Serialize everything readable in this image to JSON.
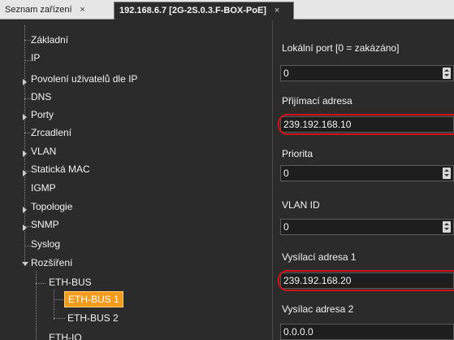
{
  "tabs": [
    {
      "label": "Seznam zařízení",
      "close": "×"
    },
    {
      "label": "192.168.6.7 [2G-2S.0.3.F-BOX-PoE]",
      "close": "×"
    }
  ],
  "tree": {
    "items": [
      {
        "label": "Základní"
      },
      {
        "label": "IP"
      },
      {
        "label": "Povolení uživatelů dle IP"
      },
      {
        "label": "DNS"
      },
      {
        "label": "Porty"
      },
      {
        "label": "Zrcadlení"
      },
      {
        "label": "VLAN"
      },
      {
        "label": "Statická MAC"
      },
      {
        "label": "IGMP"
      },
      {
        "label": "Topologie"
      },
      {
        "label": "SNMP"
      },
      {
        "label": "Syslog"
      },
      {
        "label": "Rozšíření"
      },
      {
        "label": "ETH-BUS"
      },
      {
        "label": "ETH-BUS 1"
      },
      {
        "label": "ETH-BUS 2"
      },
      {
        "label": "ETH-IO"
      }
    ]
  },
  "properties": {
    "local_port": {
      "label": "Lokální port [0 = zakázáno]",
      "value": "0"
    },
    "receive_address": {
      "label": "Přijímací adresa",
      "value": "239.192.168.10"
    },
    "priority": {
      "label": "Priorita",
      "value": "0"
    },
    "vlan_id": {
      "label": "VLAN ID",
      "value": "0"
    },
    "send_address_1": {
      "label": "Vysílací adresa 1",
      "value": "239.192.168.20"
    },
    "send_address_2": {
      "label": "Vysílac adresa 2",
      "value": "0.0.0.0"
    }
  },
  "colors": {
    "selected": "#f59b1c",
    "highlight": "#d0121c",
    "background": "#2b2b2b"
  }
}
